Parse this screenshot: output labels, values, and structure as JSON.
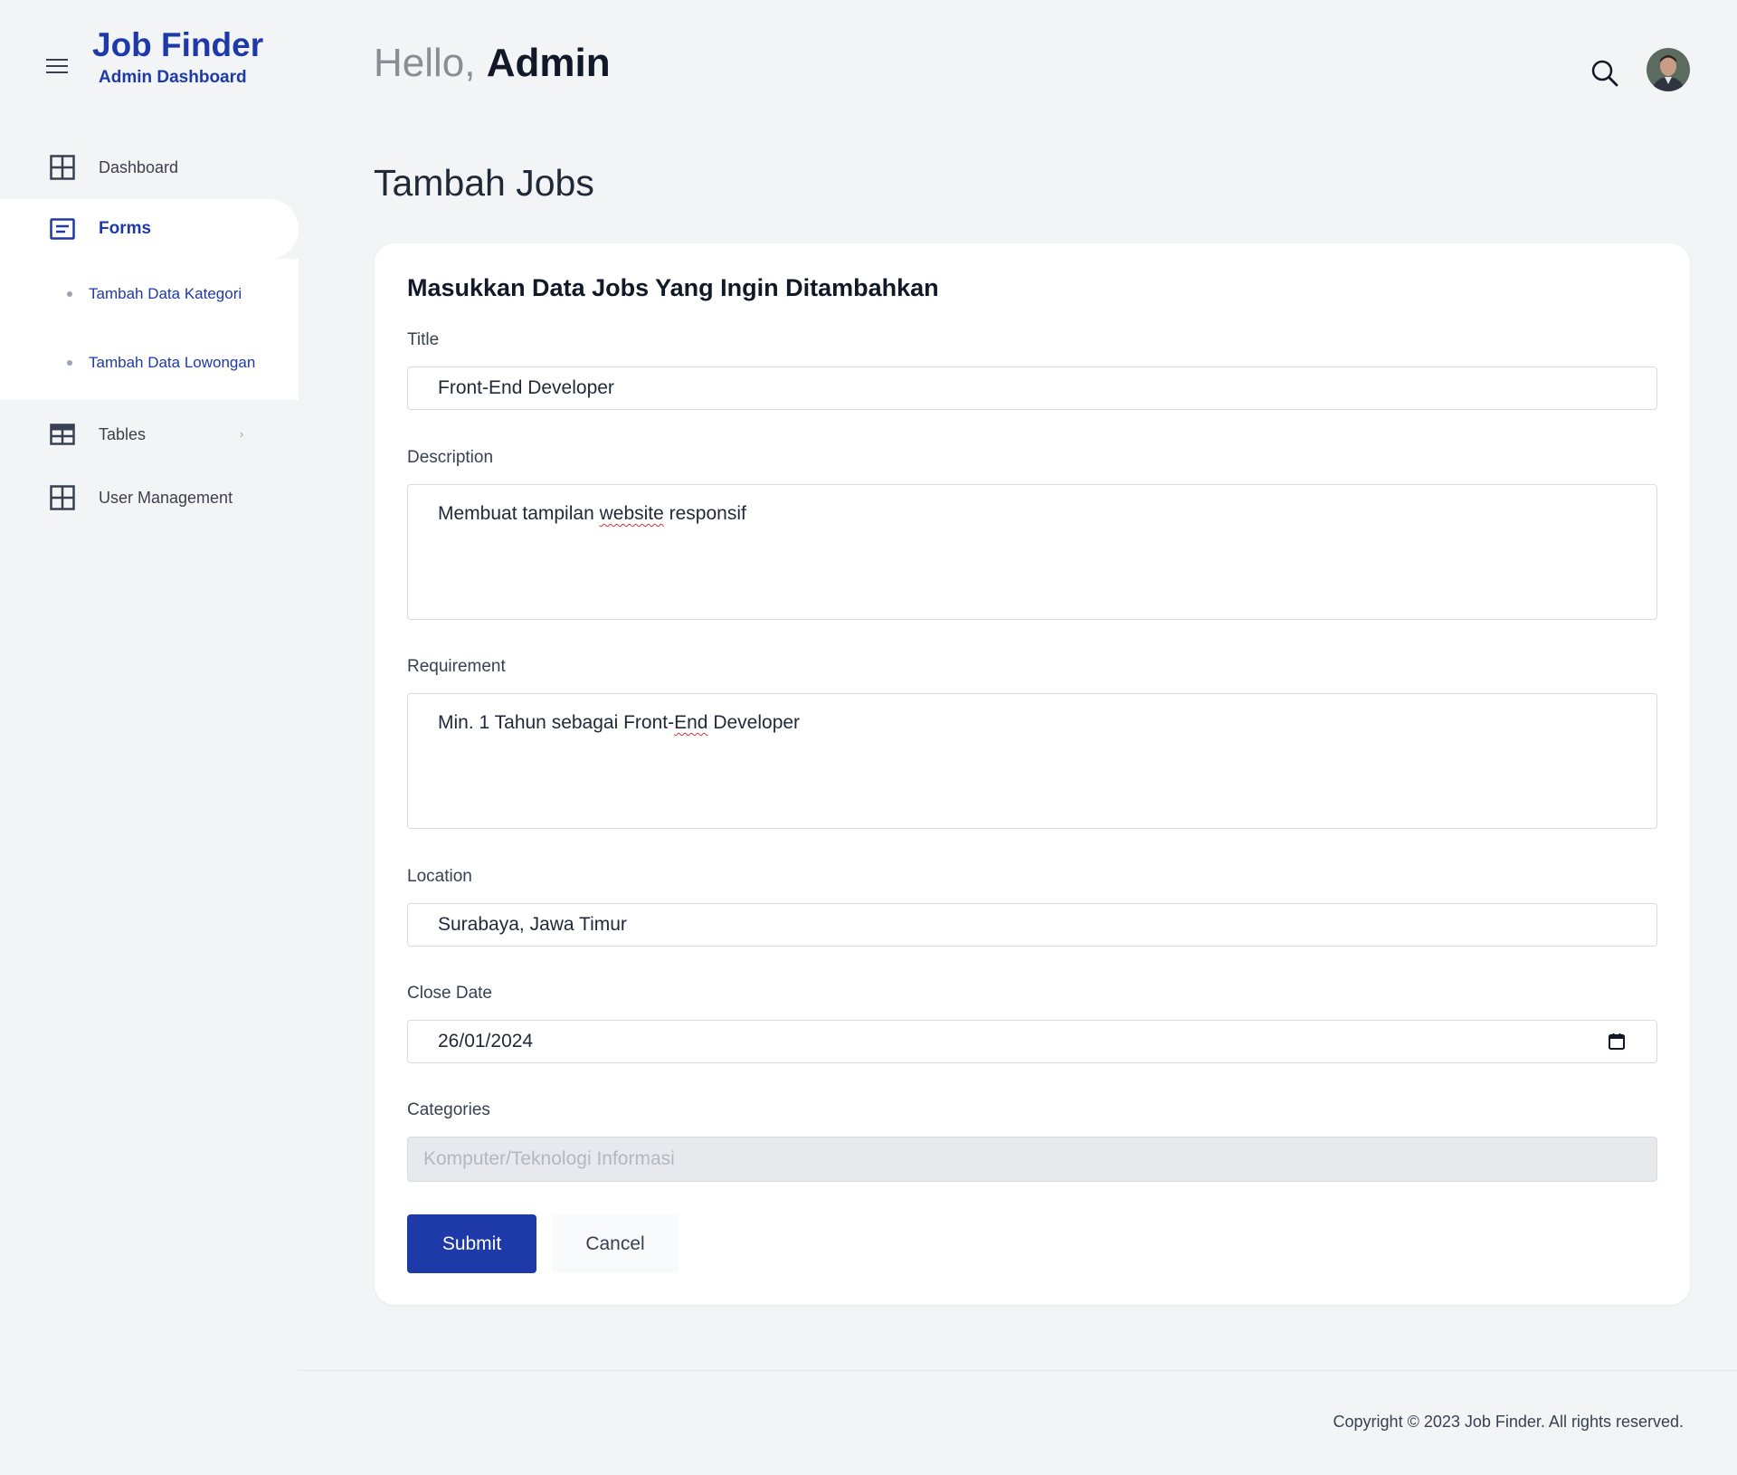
{
  "brand": {
    "title": "Job Finder",
    "subtitle": "Admin Dashboard"
  },
  "sidebar": {
    "items": [
      {
        "label": "Dashboard",
        "icon": "grid-icon"
      },
      {
        "label": "Forms",
        "icon": "form-icon",
        "active": true,
        "children": [
          {
            "label": "Tambah Data Kategori"
          },
          {
            "label": "Tambah Data Lowongan"
          }
        ]
      },
      {
        "label": "Tables",
        "icon": "table-icon",
        "chevron": "›"
      },
      {
        "label": "User Management",
        "icon": "grid-icon"
      }
    ]
  },
  "header": {
    "hello": "Hello,",
    "name": "Admin"
  },
  "page": {
    "title": "Tambah Jobs"
  },
  "form": {
    "heading": "Masukkan Data Jobs Yang Ingin Ditambahkan",
    "title_label": "Title",
    "title_value": "Front-End Developer",
    "description_label": "Description",
    "description_pre": "Membuat tampilan ",
    "description_misspelled": "website",
    "description_post": " responsif",
    "requirement_label": "Requirement",
    "requirement_pre": "Min. 1 Tahun sebagai Front-",
    "requirement_misspelled": "End",
    "requirement_post": " Developer",
    "location_label": "Location",
    "location_value": "Surabaya, Jawa Timur",
    "close_date_label": "Close Date",
    "close_date_value": "26/01/2024",
    "categories_label": "Categories",
    "categories_value": "Komputer/Teknologi Informasi",
    "submit_label": "Submit",
    "cancel_label": "Cancel"
  },
  "footer": {
    "copyright": "Copyright © 2023 Job Finder. All rights reserved."
  },
  "colors": {
    "brand": "#1e3aa8",
    "background": "#f3f4f6",
    "card": "#ffffff"
  }
}
